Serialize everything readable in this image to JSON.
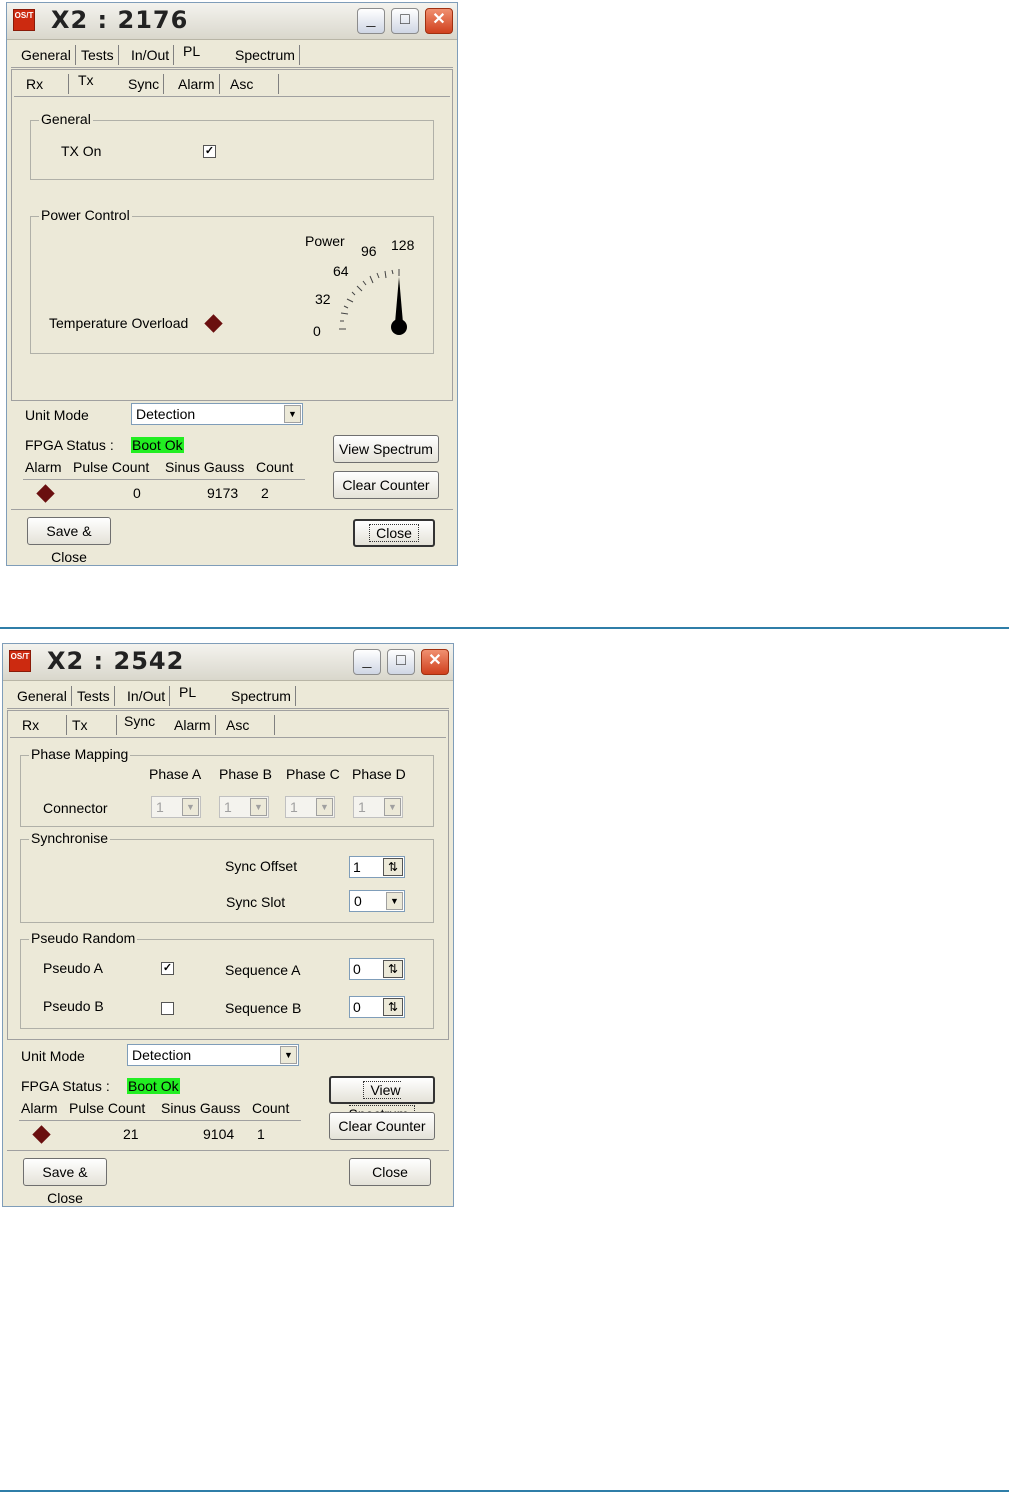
{
  "window1": {
    "title": "X2 : 2176",
    "icon_text": "OS/T",
    "tabs_main": [
      "General",
      "Tests",
      "In/Out",
      "PL",
      "Spectrum"
    ],
    "tabs_sub": [
      "Rx",
      "Tx",
      "Sync",
      "Alarm",
      "Asc"
    ],
    "general_group": "General",
    "tx_on_label": "TX On",
    "tx_on_checked": true,
    "power_group": "Power Control",
    "power_label": "Power",
    "gauge_ticks": [
      "0",
      "32",
      "64",
      "96",
      "128"
    ],
    "gauge_value": 128,
    "temp_overload_label": "Temperature Overload",
    "unit_mode_label": "Unit Mode",
    "unit_mode_value": "Detection",
    "fpga_label": "FPGA Status :",
    "fpga_value": "Boot Ok",
    "cols": [
      "Alarm",
      "Pulse Count",
      "Sinus Gauss",
      "Count"
    ],
    "pulse_count": "0",
    "sinus_gauss": "9173",
    "count": "2",
    "view_spectrum": "View Spectrum",
    "clear_counter": "Clear Counter",
    "save_close": "Save & Close",
    "close": "Close"
  },
  "window2": {
    "title": "X2 : 2542",
    "icon_text": "OS/T",
    "tabs_main": [
      "General",
      "Tests",
      "In/Out",
      "PL",
      "Spectrum"
    ],
    "tabs_sub": [
      "Rx",
      "Tx",
      "Sync",
      "Alarm",
      "Asc"
    ],
    "phase_group": "Phase Mapping",
    "phases": [
      "Phase A",
      "Phase B",
      "Phase C",
      "Phase D"
    ],
    "connector_label": "Connector",
    "connector_values": [
      "1",
      "1",
      "1",
      "1"
    ],
    "sync_group": "Synchronise",
    "sync_offset_label": "Sync Offset",
    "sync_offset_value": "1",
    "sync_slot_label": "Sync Slot",
    "sync_slot_value": "0",
    "pseudo_group": "Pseudo Random",
    "pseudo_a_label": "Pseudo A",
    "pseudo_a_checked": true,
    "pseudo_b_label": "Pseudo B",
    "pseudo_b_checked": false,
    "seq_a_label": "Sequence A",
    "seq_a_value": "0",
    "seq_b_label": "Sequence B",
    "seq_b_value": "0",
    "unit_mode_label": "Unit Mode",
    "unit_mode_value": "Detection",
    "fpga_label": "FPGA Status :",
    "fpga_value": "Boot Ok",
    "cols": [
      "Alarm",
      "Pulse Count",
      "Sinus Gauss",
      "Count"
    ],
    "pulse_count": "21",
    "sinus_gauss": "9104",
    "count": "1",
    "view_spectrum": "View Spectrum",
    "clear_counter": "Clear Counter",
    "save_close": "Save & Close",
    "close": "Close"
  },
  "colors": {
    "status_ok": "#22ee22",
    "alarm": "#6a0f0f",
    "rule": "#2f7ea8"
  }
}
